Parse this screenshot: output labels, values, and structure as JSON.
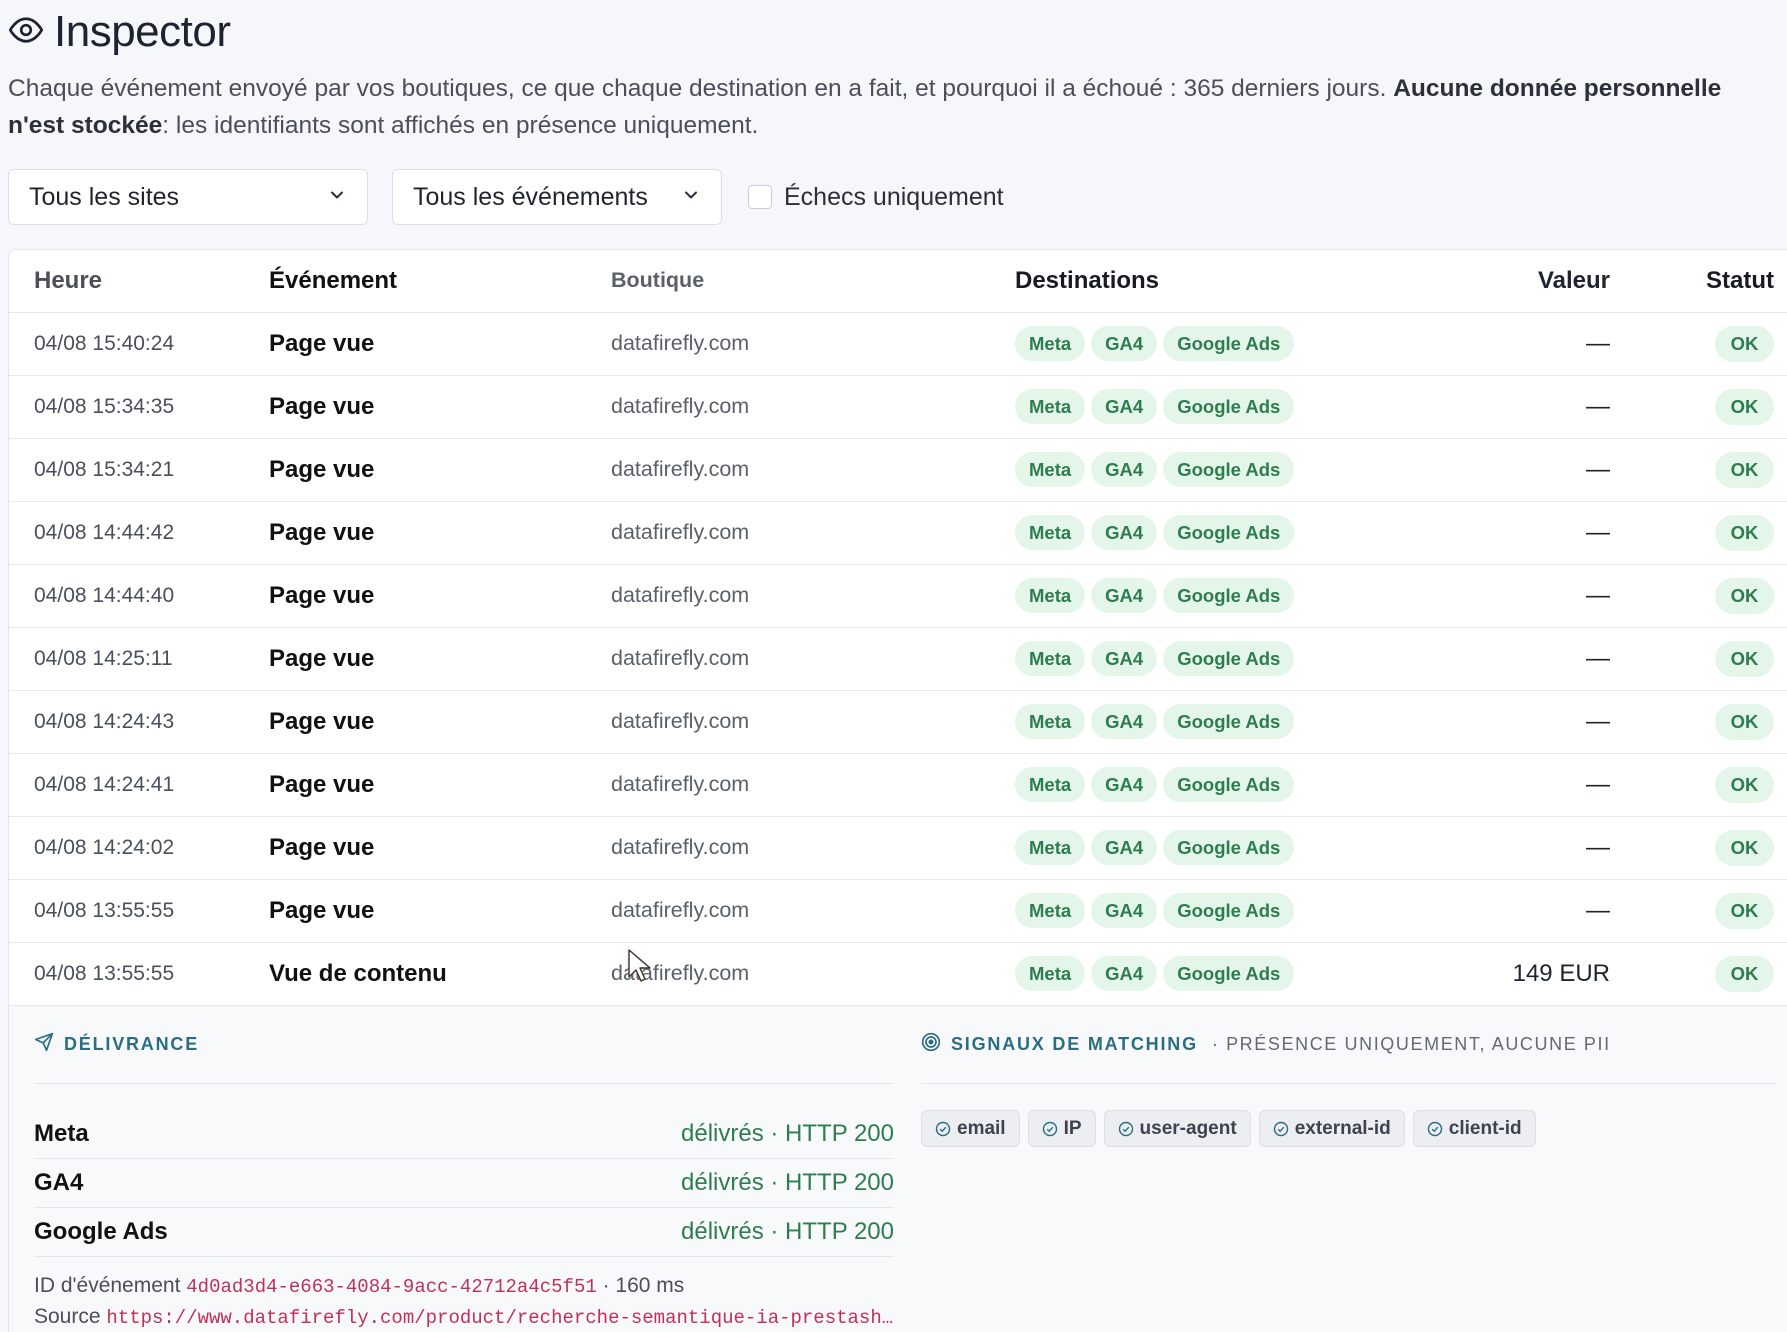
{
  "header": {
    "title": "Inspector",
    "desc_main": "Chaque événement envoyé par vos boutiques, ce que chaque destination en a fait, et pourquoi il a échoué : 365 derniers jours. ",
    "desc_bold": "Aucune donnée personnelle n'est stockée",
    "desc_tail": ": les identifiants sont affichés en présence uniquement."
  },
  "filters": {
    "site_select": "Tous les sites",
    "event_select": "Tous les événements",
    "failures_only_label": "Échecs uniquement",
    "failures_only_checked": false
  },
  "table": {
    "headers": {
      "time": "Heure",
      "event": "Événement",
      "shop": "Boutique",
      "destinations": "Destinations",
      "value": "Valeur",
      "status": "Statut"
    },
    "rows": [
      {
        "time": "04/08 15:40:24",
        "event": "Page vue",
        "shop": "datafirefly.com",
        "destinations": [
          "Meta",
          "GA4",
          "Google Ads"
        ],
        "value": "—",
        "status": "OK"
      },
      {
        "time": "04/08 15:34:35",
        "event": "Page vue",
        "shop": "datafirefly.com",
        "destinations": [
          "Meta",
          "GA4",
          "Google Ads"
        ],
        "value": "—",
        "status": "OK"
      },
      {
        "time": "04/08 15:34:21",
        "event": "Page vue",
        "shop": "datafirefly.com",
        "destinations": [
          "Meta",
          "GA4",
          "Google Ads"
        ],
        "value": "—",
        "status": "OK"
      },
      {
        "time": "04/08 14:44:42",
        "event": "Page vue",
        "shop": "datafirefly.com",
        "destinations": [
          "Meta",
          "GA4",
          "Google Ads"
        ],
        "value": "—",
        "status": "OK"
      },
      {
        "time": "04/08 14:44:40",
        "event": "Page vue",
        "shop": "datafirefly.com",
        "destinations": [
          "Meta",
          "GA4",
          "Google Ads"
        ],
        "value": "—",
        "status": "OK"
      },
      {
        "time": "04/08 14:25:11",
        "event": "Page vue",
        "shop": "datafirefly.com",
        "destinations": [
          "Meta",
          "GA4",
          "Google Ads"
        ],
        "value": "—",
        "status": "OK"
      },
      {
        "time": "04/08 14:24:43",
        "event": "Page vue",
        "shop": "datafirefly.com",
        "destinations": [
          "Meta",
          "GA4",
          "Google Ads"
        ],
        "value": "—",
        "status": "OK"
      },
      {
        "time": "04/08 14:24:41",
        "event": "Page vue",
        "shop": "datafirefly.com",
        "destinations": [
          "Meta",
          "GA4",
          "Google Ads"
        ],
        "value": "—",
        "status": "OK"
      },
      {
        "time": "04/08 14:24:02",
        "event": "Page vue",
        "shop": "datafirefly.com",
        "destinations": [
          "Meta",
          "GA4",
          "Google Ads"
        ],
        "value": "—",
        "status": "OK"
      },
      {
        "time": "04/08 13:55:55",
        "event": "Page vue",
        "shop": "datafirefly.com",
        "destinations": [
          "Meta",
          "GA4",
          "Google Ads"
        ],
        "value": "—",
        "status": "OK"
      },
      {
        "time": "04/08 13:55:55",
        "event": "Vue de contenu",
        "shop": "datafirefly.com",
        "destinations": [
          "Meta",
          "GA4",
          "Google Ads"
        ],
        "value": "149 EUR",
        "status": "OK"
      }
    ]
  },
  "detail": {
    "delivery": {
      "title": "DÉLIVRANCE",
      "rows": [
        {
          "name": "Meta",
          "status": "délivrés · HTTP 200"
        },
        {
          "name": "GA4",
          "status": "délivrés · HTTP 200"
        },
        {
          "name": "Google Ads",
          "status": "délivrés · HTTP 200"
        }
      ],
      "event_id_label": "ID d'événement",
      "event_id": "4d0ad3d4-e663-4084-9acc-42712a4c5f51",
      "latency": " · 160 ms",
      "source_label": "Source",
      "source_url": "https://www.datafirefly.com/product/recherche-semantique-ia-prestash…"
    },
    "signals": {
      "title": "SIGNAUX DE MATCHING",
      "subtitle": "· PRÉSENCE UNIQUEMENT, AUCUNE PII",
      "chips": [
        "email",
        "IP",
        "user-agent",
        "external-id",
        "client-id"
      ]
    }
  },
  "colors": {
    "accent_teal": "#2b6e84",
    "success_green": "#2e7d4f",
    "success_bg": "#e4f5e9",
    "code_pink": "#c0305a"
  }
}
